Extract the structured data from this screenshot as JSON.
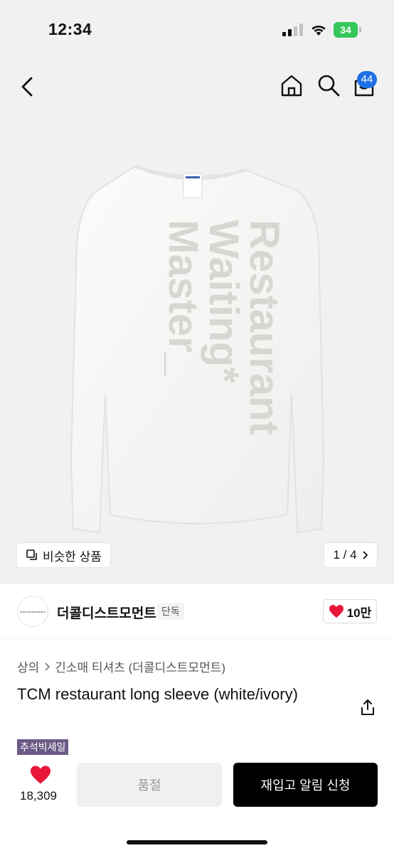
{
  "status_bar": {
    "time": "12:34",
    "battery": "34"
  },
  "nav": {
    "cart_count": "44"
  },
  "gallery": {
    "similar_label": "비슷한 상품",
    "page_indicator": "1 / 4",
    "print_lines": [
      "Restaurant",
      "Waiting*",
      "Master_"
    ]
  },
  "brand": {
    "logo_text": "thecoolestmoment",
    "name": "더콜디스트모먼트",
    "tag": "단독",
    "likes": "10만"
  },
  "breadcrumb": {
    "category": "상의",
    "subcategory": "긴소매 티셔츠 (더콜디스트모먼트)"
  },
  "product": {
    "title": "TCM restaurant long sleeve (white/ivory)",
    "badge": "추석빅세일"
  },
  "bottom": {
    "wish_count": "18,309",
    "soldout_label": "품절",
    "restock_label": "재입고 알림 신청"
  },
  "colors": {
    "badge_blue": "#1f6fe5",
    "heart_red": "#e8173a",
    "sale_purple": "#6b5a86",
    "battery_green": "#34c759"
  }
}
